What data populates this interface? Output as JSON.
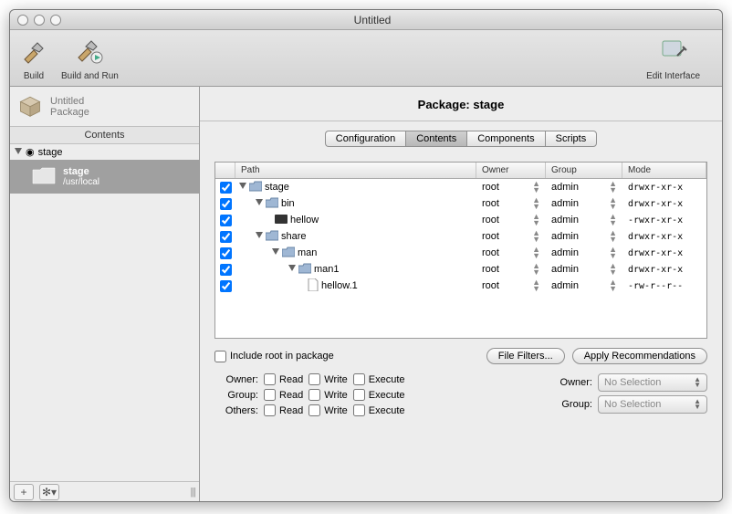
{
  "window": {
    "title": "Untitled"
  },
  "toolbar": {
    "build": "Build",
    "build_run": "Build and Run",
    "edit_interface": "Edit Interface"
  },
  "sidebar": {
    "head1": "Untitled",
    "head2": "Package",
    "section": "Contents",
    "tree_item": "stage",
    "sub_name": "stage",
    "sub_path": "/usr/local",
    "footer_plus": "+",
    "footer_gear": "✻▾"
  },
  "main_title": "Package: stage",
  "tabs": [
    "Configuration",
    "Contents",
    "Components",
    "Scripts"
  ],
  "active_tab_index": 1,
  "table": {
    "headers": {
      "path": "Path",
      "owner": "Owner",
      "group": "Group",
      "mode": "Mode"
    },
    "rows": [
      {
        "indent": 0,
        "arrow": true,
        "kind": "folder",
        "name": "stage",
        "owner": "root",
        "group": "admin",
        "mode": "drwxr-xr-x"
      },
      {
        "indent": 1,
        "arrow": true,
        "kind": "folder",
        "name": "bin",
        "owner": "root",
        "group": "admin",
        "mode": "drwxr-xr-x"
      },
      {
        "indent": 2,
        "arrow": false,
        "kind": "exec",
        "name": "hellow",
        "owner": "root",
        "group": "admin",
        "mode": "-rwxr-xr-x"
      },
      {
        "indent": 1,
        "arrow": true,
        "kind": "folder",
        "name": "share",
        "owner": "root",
        "group": "admin",
        "mode": "drwxr-xr-x"
      },
      {
        "indent": 2,
        "arrow": true,
        "kind": "folder",
        "name": "man",
        "owner": "root",
        "group": "admin",
        "mode": "drwxr-xr-x"
      },
      {
        "indent": 3,
        "arrow": true,
        "kind": "folder",
        "name": "man1",
        "owner": "root",
        "group": "admin",
        "mode": "drwxr-xr-x"
      },
      {
        "indent": 4,
        "arrow": false,
        "kind": "file",
        "name": "hellow.1",
        "owner": "root",
        "group": "admin",
        "mode": "-rw-r--r--"
      }
    ]
  },
  "options": {
    "include_root": "Include root in package",
    "file_filters": "File Filters...",
    "apply_rec": "Apply Recommendations"
  },
  "perms": {
    "owner_label": "Owner:",
    "group_label": "Group:",
    "others_label": "Others:",
    "read": "Read",
    "write": "Write",
    "execute": "Execute",
    "no_selection": "No Selection"
  }
}
